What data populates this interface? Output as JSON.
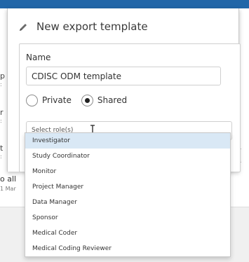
{
  "modal": {
    "title": "New export template",
    "name_label": "Name",
    "name_value": "CDISC ODM template",
    "visibility": {
      "options": [
        {
          "label": "Private",
          "checked": false
        },
        {
          "label": "Shared",
          "checked": true
        }
      ]
    },
    "roles": {
      "placeholder": "Select role(s)",
      "options": [
        "Investigator",
        "Study Coordinator",
        "Monitor",
        "Project Manager",
        "Data Manager",
        "Sponsor",
        "Medical Coder",
        "Medical Coding Reviewer"
      ],
      "highlighted_index": 0
    }
  },
  "background": {
    "fragments": [
      "p",
      ":",
      "r",
      ":",
      "t",
      ":",
      "o all",
      "1 Mar"
    ]
  },
  "colors": {
    "accent": "#2166a8",
    "highlight": "#d9e8f5"
  }
}
